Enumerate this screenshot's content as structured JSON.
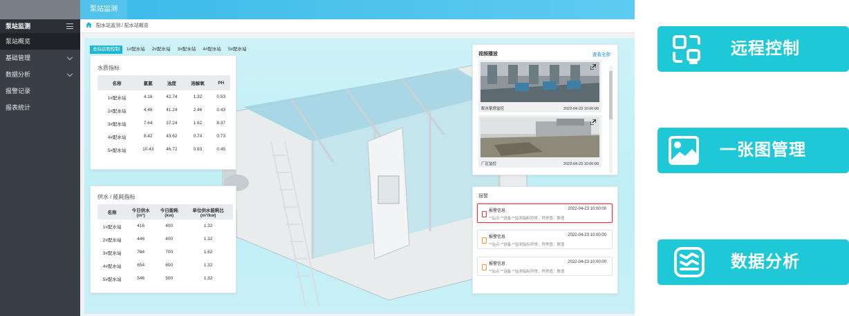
{
  "topbar": {
    "tab": "泵站监测"
  },
  "sidebar": {
    "title": "泵站监测",
    "items": [
      {
        "label": "泵站概览",
        "active": true
      },
      {
        "label": "基础管理",
        "expandable": true
      },
      {
        "label": "数据分析",
        "expandable": true
      },
      {
        "label": "报警记录"
      },
      {
        "label": "报表统计"
      }
    ]
  },
  "breadcrumb": {
    "text": "配水站监测 / 配水站概览"
  },
  "station_tabs": [
    "总站远程控制",
    "1#配水站",
    "2#配水站",
    "3#配水站",
    "4#配水站",
    "5#配水站"
  ],
  "water_quality": {
    "title": "水质指标",
    "columns": [
      "名称",
      "氯氯",
      "浊度",
      "溶解氧",
      "PH"
    ],
    "rows": [
      [
        "1#配水站",
        "4.16",
        "42.74",
        "1.32",
        "0.53"
      ],
      [
        "2#配水站",
        "4.46",
        "41.24",
        "2.46",
        "0.43"
      ],
      [
        "3#配水站",
        "7.64",
        "37.24",
        "1.62",
        "8.37"
      ],
      [
        "4#配水站",
        "8.42",
        "43.62",
        "0.74",
        "0.73"
      ],
      [
        "5#配水站",
        "10.43",
        "46.72",
        "0.83",
        "0.45"
      ]
    ]
  },
  "supply": {
    "title": "供水 / 能耗指标",
    "columns": [
      {
        "l1": "名称",
        "l2": ""
      },
      {
        "l1": "今日供水",
        "l2": "(m³)"
      },
      {
        "l1": "今日能耗",
        "l2": "(kw)"
      },
      {
        "l1": "单位供水能耗比",
        "l2": "(m³/kw)"
      }
    ],
    "rows": [
      [
        "1#配水站",
        "416",
        "400",
        "1.32"
      ],
      [
        "2#配水站",
        "446",
        "400",
        "1.32"
      ],
      [
        "3#配水站",
        "764",
        "700",
        "1.62"
      ],
      [
        "4#配水站",
        "654",
        "600",
        "1.32"
      ],
      [
        "5#配水站",
        "546",
        "500",
        "1.32"
      ]
    ]
  },
  "video": {
    "title": "视频播放",
    "view_all": "查看全部",
    "cams": [
      {
        "name": "配水泵房监控",
        "time": "2022-04-23 10:00:00"
      },
      {
        "name": "厂区监控",
        "time": "2022-04-23 10:00:00"
      }
    ]
  },
  "alarms": {
    "title": "报警",
    "items": [
      {
        "title": "报警信息",
        "time": "2022-04-23 10:00:00",
        "desc": "**站点:**设备:**监测指标异常，异常值：数值",
        "highlight": true
      },
      {
        "title": "报警信息",
        "time": "2022-04-23 10:00:00",
        "desc": "**站点:**设备:**监测指标异常，异常值：数值"
      },
      {
        "title": "报警信息",
        "time": "2022-04-23 10:00:00",
        "desc": "**站点:**设备:**监测指标异常，异常值：数值"
      }
    ]
  },
  "features": [
    {
      "label": "远程控制",
      "icon": "remote-control-icon"
    },
    {
      "label": "一张图管理",
      "icon": "image-icon"
    },
    {
      "label": "数据分析",
      "icon": "data-analysis-icon"
    }
  ],
  "colors": {
    "accent": "#1ec8d6",
    "topbar": "#35b8e8",
    "sidebar": "#3a3f47",
    "alarm_red": "#d9363e",
    "alarm_orange": "#f39c2b"
  }
}
